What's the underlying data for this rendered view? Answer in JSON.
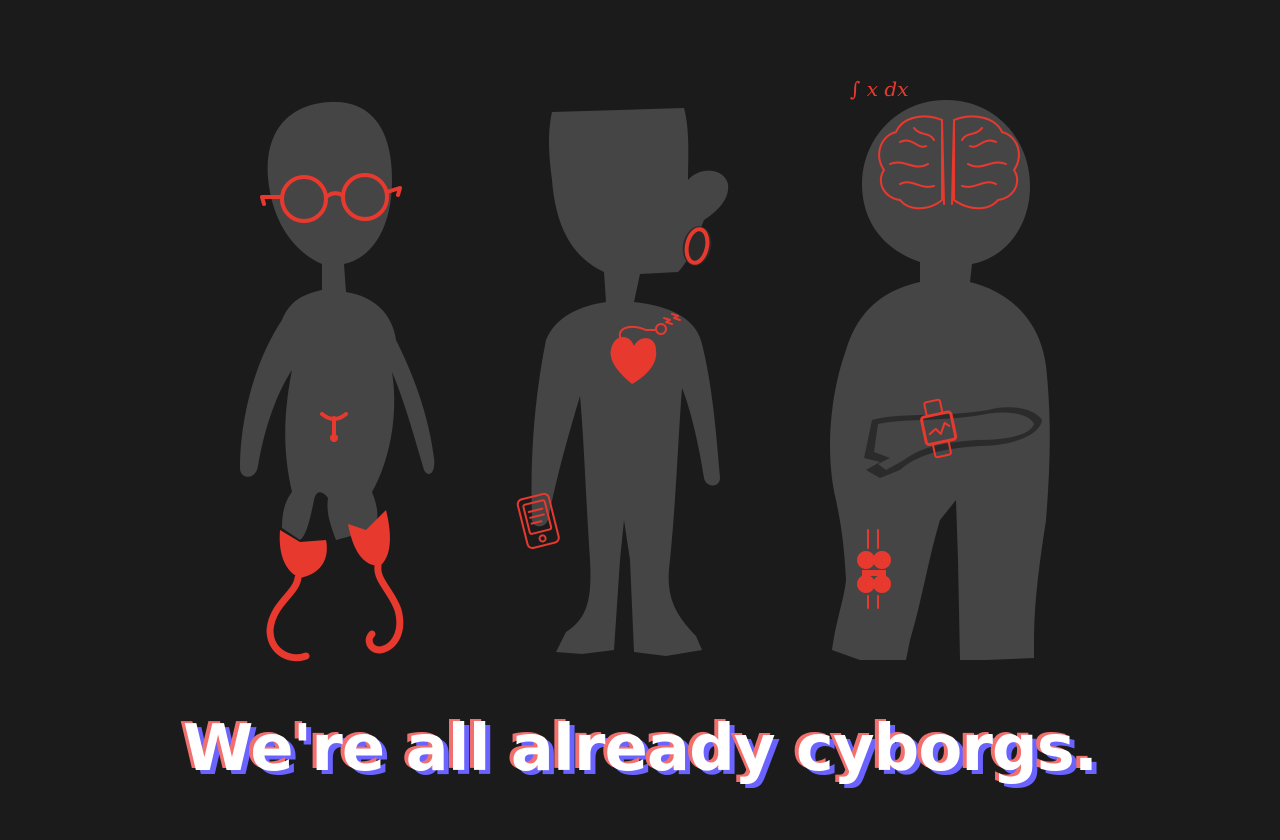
{
  "headline": "We're all already cyborgs.",
  "equation": "∫ x dx",
  "colors": {
    "background": "#1b1b1b",
    "silhouette": "#454545",
    "accent_red": "#e8392f",
    "headline_fill": "#ffffff",
    "headline_shadow_red": "#f1706e",
    "headline_shadow_blue": "#6b63ff"
  },
  "figures": [
    {
      "name": "figure-with-glasses-and-prosthetic-legs",
      "devices": [
        "glasses-icon",
        "iud-icon",
        "prosthetic-leg-icon"
      ]
    },
    {
      "name": "figure-with-pacemaker",
      "devices": [
        "hearing-aid-icon",
        "pacemaker-heart-icon",
        "phone-icon"
      ]
    },
    {
      "name": "figure-with-brain",
      "devices": [
        "brain-icon",
        "smartwatch-icon",
        "knee-implant-icon"
      ]
    }
  ]
}
